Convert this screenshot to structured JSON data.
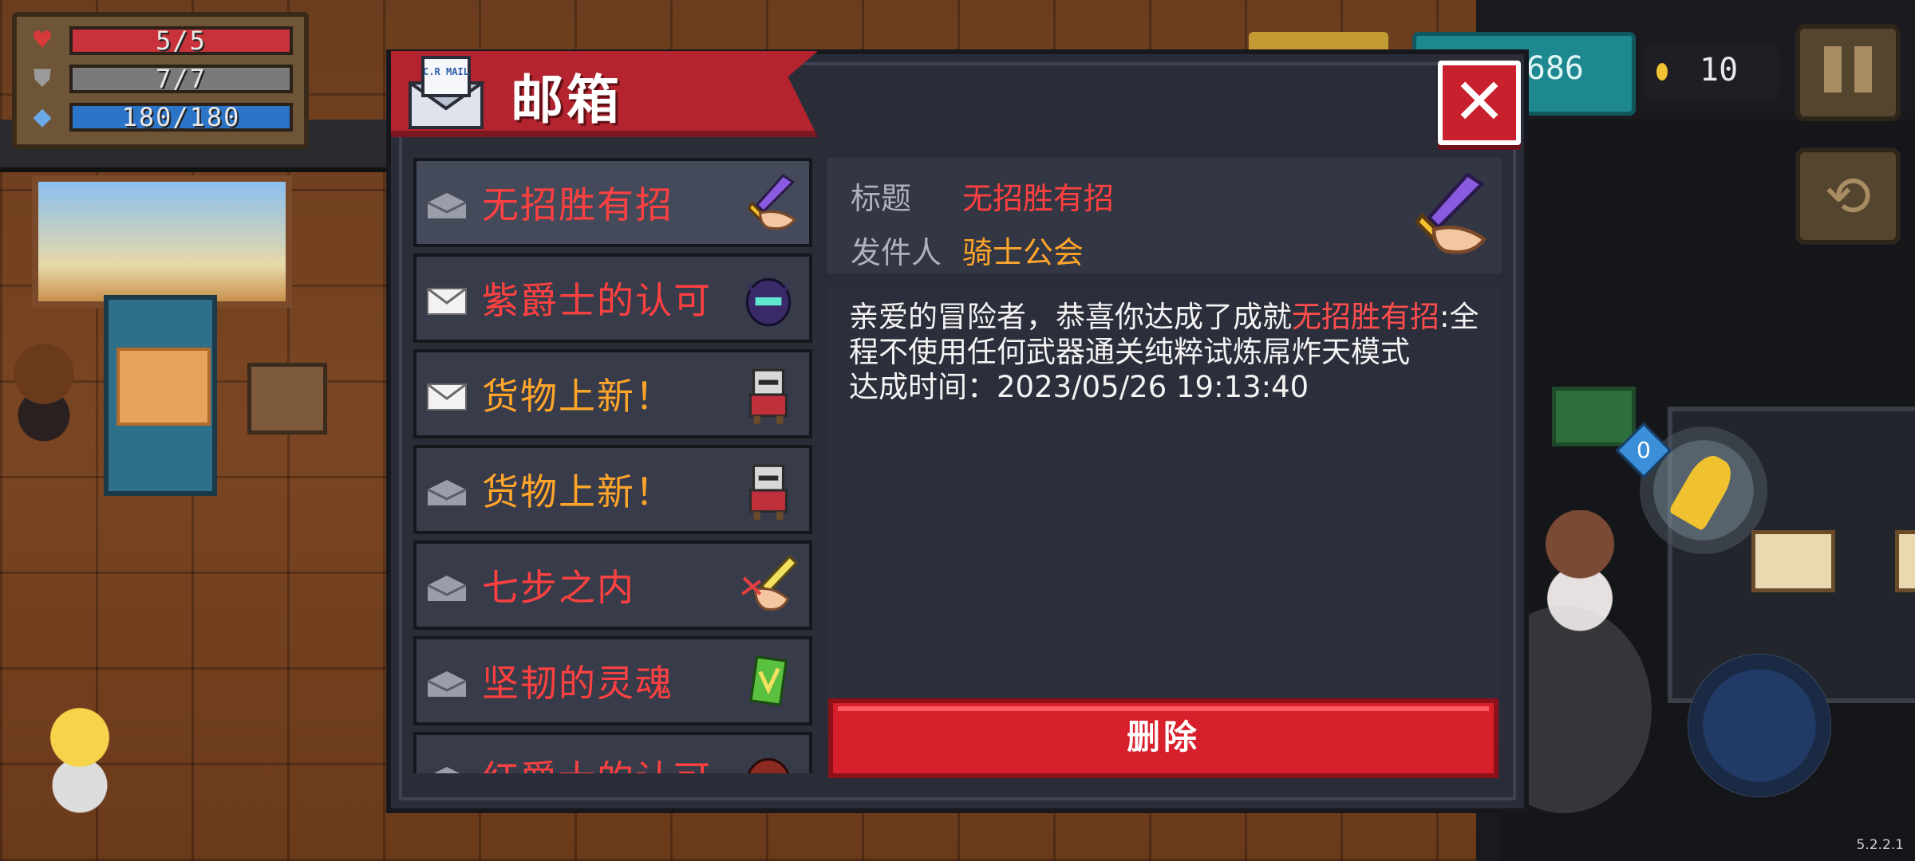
{
  "hud": {
    "health": "5/5",
    "health_fill": 1.0,
    "armor": "7/7",
    "armor_fill": 1.0,
    "energy": "180/180",
    "energy_fill": 1.0,
    "gems": "686",
    "coins": "10",
    "version": "5.2.2.1"
  },
  "scene": {
    "weapon_energy_cost": "0"
  },
  "colors": {
    "health_bar": "#c8323a",
    "armor_bar": "#7a7a7a",
    "energy_bar": "#2b74c8",
    "title_red": "#ff4040",
    "title_orange": "#ffa52a",
    "accent_red": "#c8202d"
  },
  "mailbox": {
    "header_icon_text": "C.R MAIL",
    "title": "邮箱",
    "close_label": "✕",
    "items": [
      {
        "subject": "无招胜有招",
        "read": true,
        "color": "#ff4040",
        "icon": "sword-hand-icon"
      },
      {
        "subject": "紫爵士的认可",
        "read": false,
        "color": "#ff4040",
        "icon": "knight-helmet-icon"
      },
      {
        "subject": "货物上新！",
        "read": false,
        "color": "#ffa52a",
        "icon": "merchant-icon"
      },
      {
        "subject": "货物上新！",
        "read": true,
        "color": "#ffa52a",
        "icon": "merchant-icon"
      },
      {
        "subject": "七步之内",
        "read": true,
        "color": "#ff4040",
        "icon": "blade-hand-icon"
      },
      {
        "subject": "坚韧的灵魂",
        "read": true,
        "color": "#ff4040",
        "icon": "green-card-icon"
      },
      {
        "subject": "红爵士的认可",
        "read": true,
        "color": "#ff4040",
        "icon": "red-knight-icon"
      }
    ],
    "detail": {
      "title_label": "标题",
      "title_value": "无招胜有招",
      "sender_label": "发件人",
      "sender_value": "骑士公会",
      "body_part1": "亲爱的冒险者，恭喜你达成了成就",
      "body_highlight": "无招胜有招",
      "body_part2": ":全程不使用任何武器通关纯粹试炼屌炸天模式",
      "achieved_time": "达成时间：2023/05/26 19:13:40"
    },
    "delete_label": "删除"
  }
}
